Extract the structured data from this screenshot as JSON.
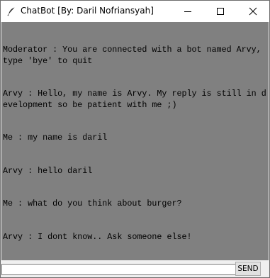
{
  "window": {
    "title": "ChatBot [By: Daril Nofriansyah]",
    "icon": "feather-icon"
  },
  "controls": {
    "minimize_icon": "minimize-icon",
    "maximize_icon": "maximize-icon",
    "close_icon": "close-icon"
  },
  "chat": {
    "background": "#808080",
    "lines": [
      "Moderator : You are connected with a bot named Arvy, type 'bye' to quit",
      "Arvy : Hello, my name is Arvy. My reply is still in development so be patient with me ;)",
      "Me : my name is daril",
      "Arvy : hello daril",
      "Me : what do you think about burger?",
      "Arvy : I dont know.. Ask someone else!"
    ]
  },
  "input": {
    "value": "",
    "placeholder": ""
  },
  "send_label": "SEND"
}
